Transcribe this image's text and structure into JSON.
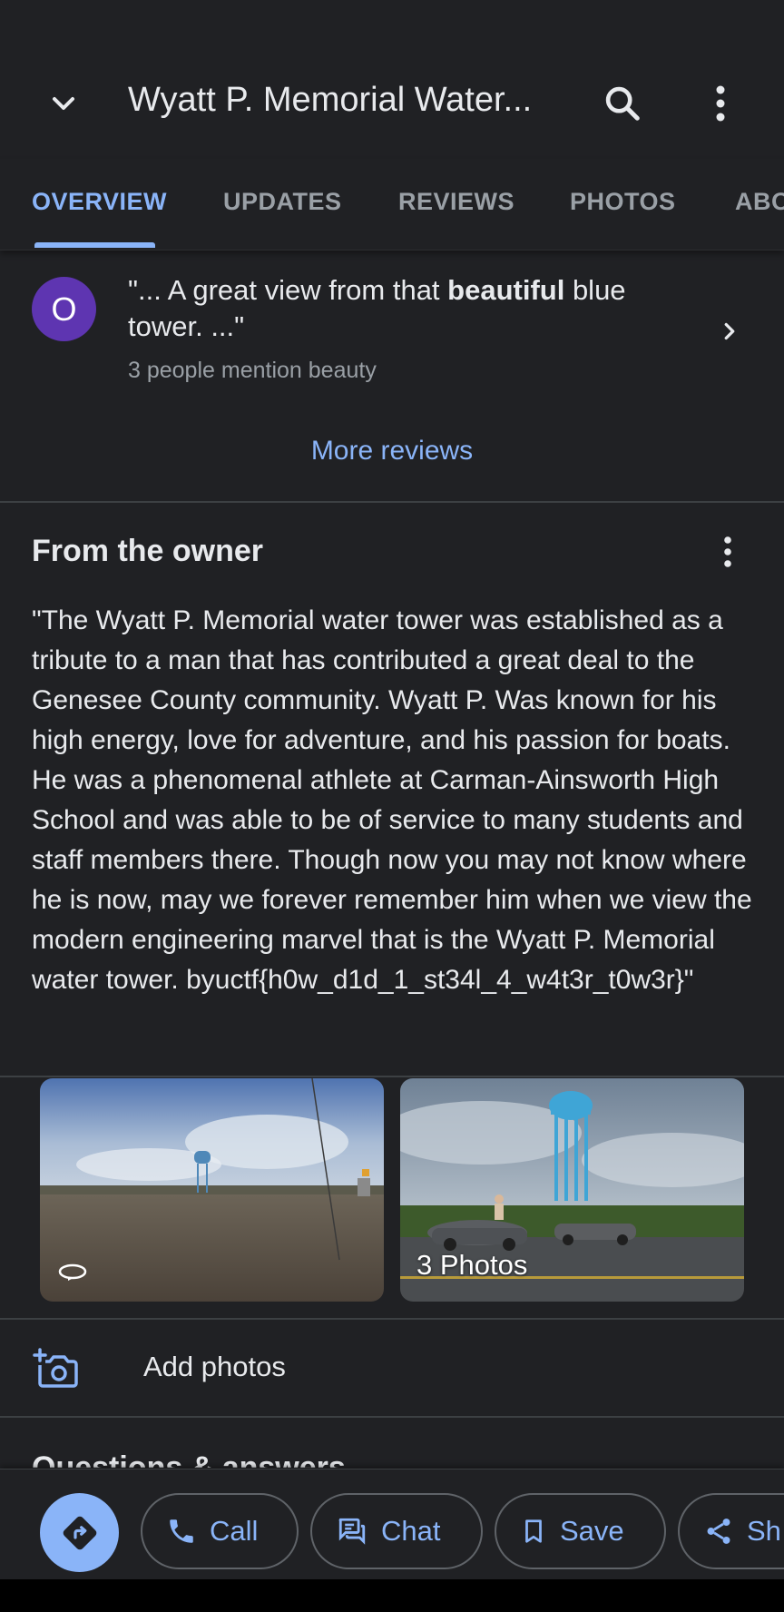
{
  "header": {
    "title": "Wyatt P. Memorial Water...",
    "collapse_icon": "chevron-down-icon",
    "search_icon": "search-icon",
    "more_icon": "more-vert-icon"
  },
  "tabs": [
    {
      "label": "OVERVIEW",
      "active": true
    },
    {
      "label": "UPDATES",
      "active": false
    },
    {
      "label": "REVIEWS",
      "active": false
    },
    {
      "label": "PHOTOS",
      "active": false
    },
    {
      "label": "ABO",
      "active": false
    }
  ],
  "review_snippet": {
    "avatar_letter": "O",
    "quote_prefix": "\"... A great view from that ",
    "quote_highlight": "beautiful",
    "quote_suffix": " blue tower. ...\"",
    "mention": "3 people mention beauty"
  },
  "more_reviews_label": "More reviews",
  "owner": {
    "title": "From the owner",
    "text": "\"The Wyatt P. Memorial water tower was established as a tribute to a man that has contributed a great deal to the Genesee County community. Wyatt P. Was known for his high energy, love for adventure, and his passion for boats. He was a phenomenal athlete at Carman-Ainsworth High School and was able to be of service to many students and staff members there. Though now you may not know where he is now, may we forever remember him when we view the modern engineering marvel that is the Wyatt P. Memorial water tower. byuctf{h0w_d1d_1_st34l_4_w4t3r_t0w3r}\""
  },
  "photos": {
    "right_label": "3 Photos"
  },
  "add_photos_label": "Add photos",
  "next_section_title": "Questions & answers",
  "actions": {
    "call": "Call",
    "chat": "Chat",
    "save": "Save",
    "share": "Sh"
  },
  "colors": {
    "background": "#202124",
    "accent": "#8ab4f8",
    "avatar": "#5e35b1",
    "secondary_text": "#9aa0a6"
  }
}
